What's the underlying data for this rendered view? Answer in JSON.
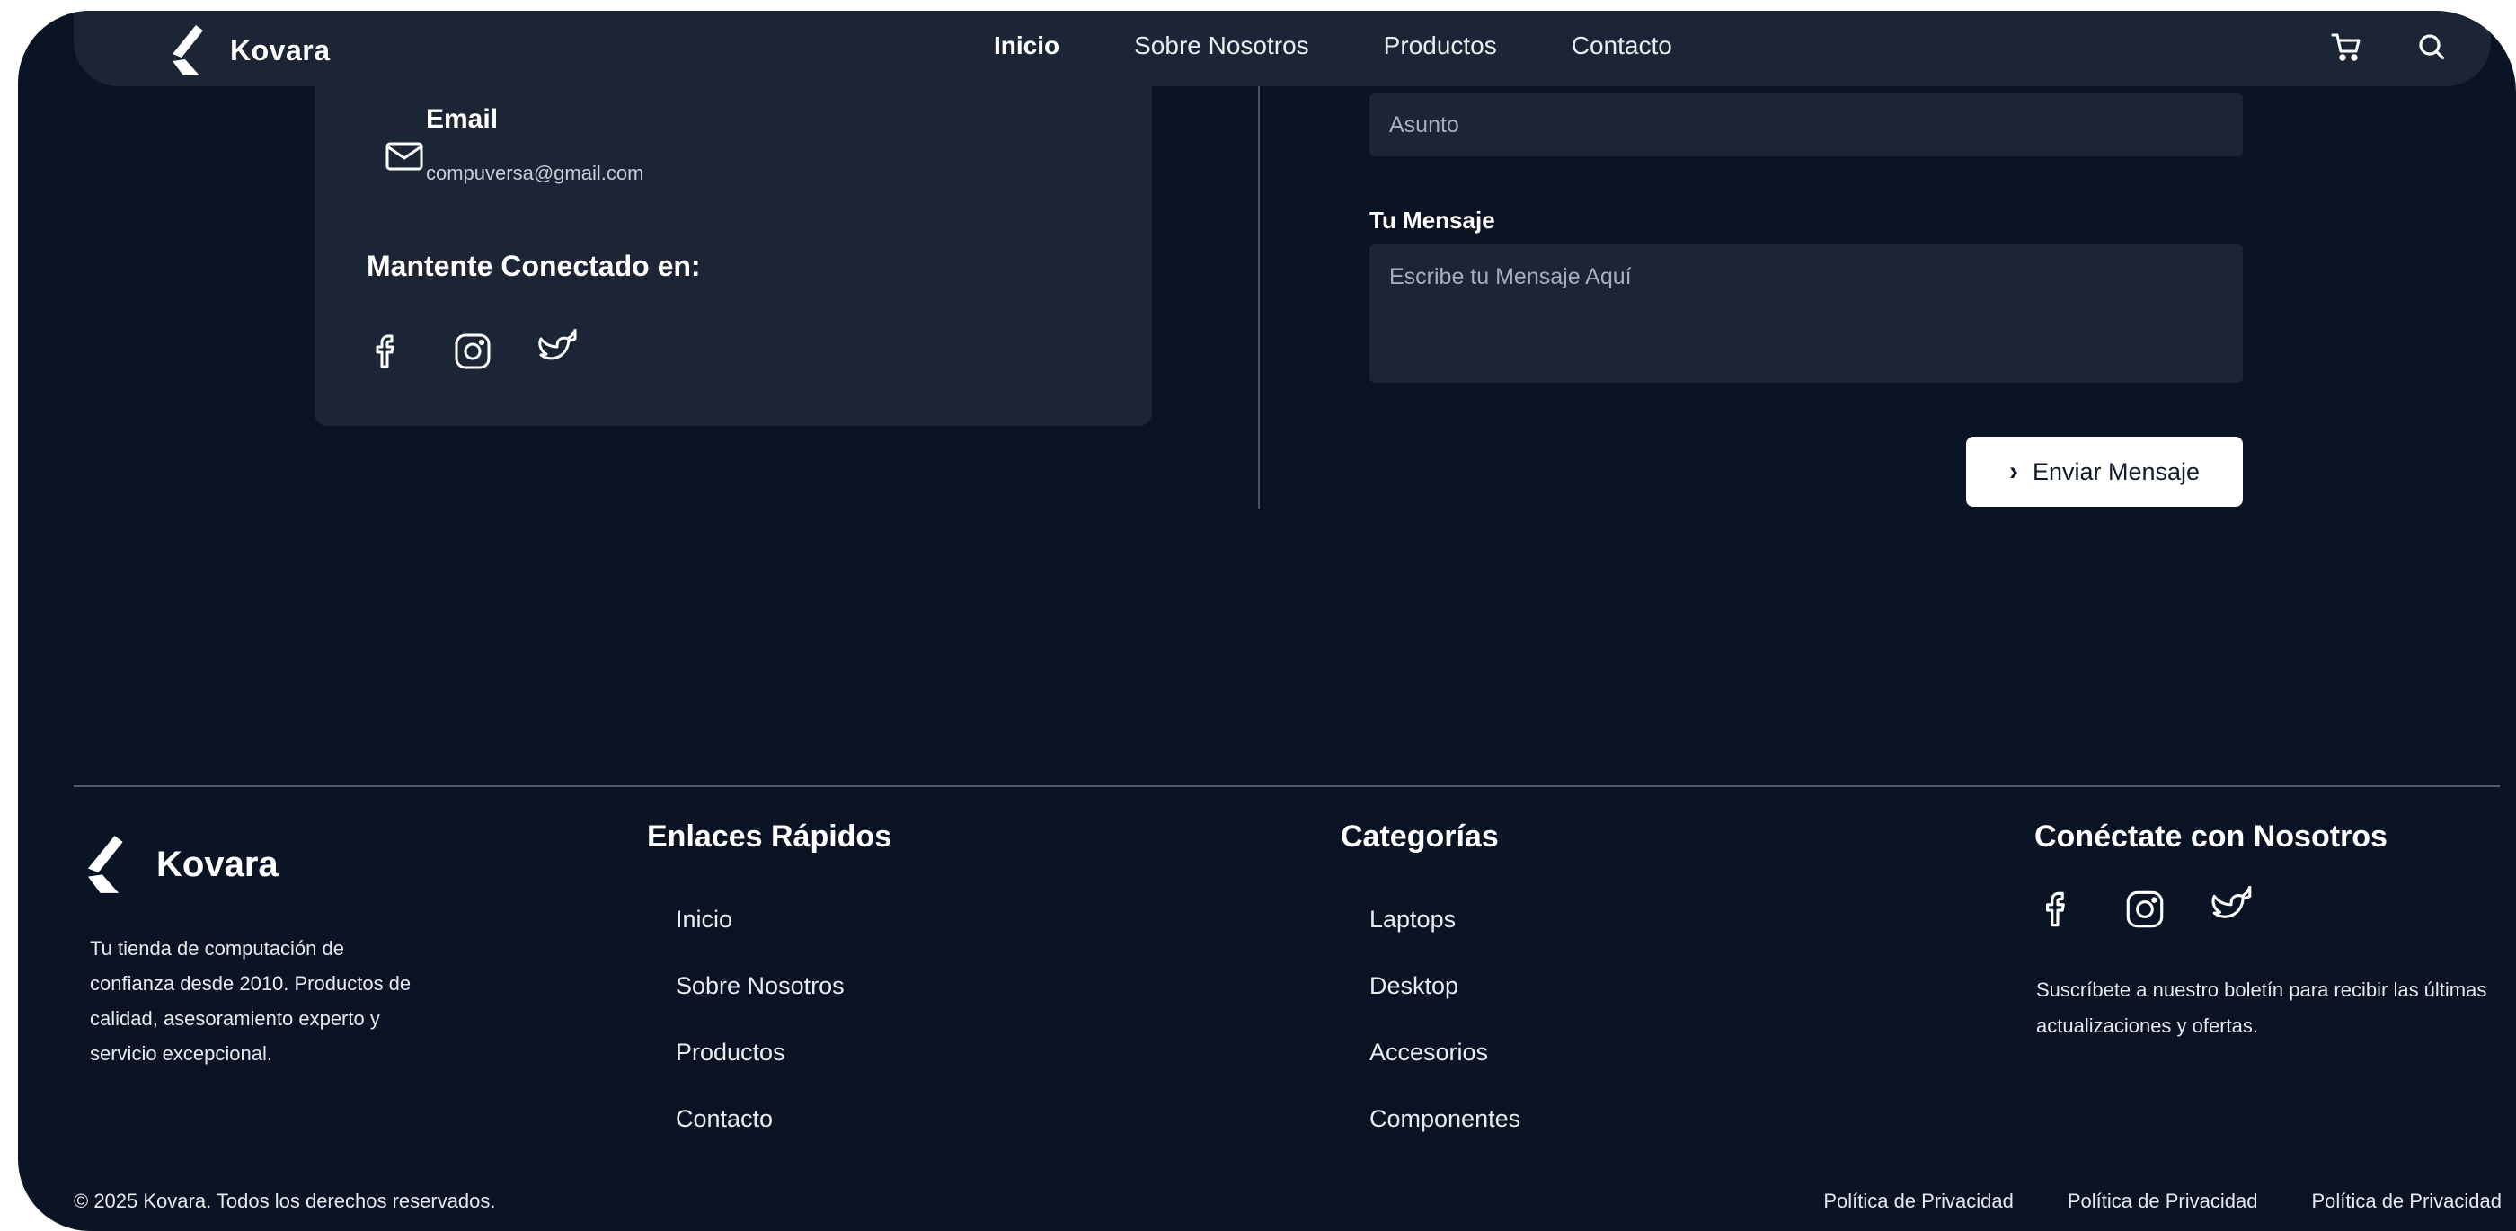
{
  "brand": {
    "name": "Kovara"
  },
  "nav": {
    "links": [
      "Inicio",
      "Sobre Nosotros",
      "Productos",
      "Contacto"
    ],
    "active": "Inicio",
    "icons": [
      "cart-icon",
      "search-icon"
    ]
  },
  "contact_card": {
    "email_title": "Email",
    "email_value": "compuversa@gmail.com",
    "connected_title": "Mantente Conectado en:",
    "socials": [
      "facebook-icon",
      "instagram-icon",
      "twitter-icon"
    ]
  },
  "form": {
    "subject_placeholder": "Asunto",
    "message_label": "Tu Mensaje",
    "message_placeholder": "Escribe tu Mensaje Aquí",
    "submit_label": "Enviar Mensaje"
  },
  "footer": {
    "brand": "Kovara",
    "description": "Tu tienda de computación de confianza desde 2010. Productos de calidad, asesoramiento experto y servicio excepcional.",
    "quick_links": {
      "title": "Enlaces Rápidos",
      "items": [
        "Inicio",
        "Sobre Nosotros",
        "Productos",
        "Contacto"
      ]
    },
    "categories": {
      "title": "Categorías",
      "items": [
        "Laptops",
        "Desktop",
        "Accesorios",
        "Componentes"
      ]
    },
    "connect": {
      "title": "Conéctate con Nosotros",
      "socials": [
        "facebook-icon",
        "instagram-icon",
        "twitter-icon"
      ],
      "newsletter": "Suscríbete a nuestro boletín para recibir las últimas actualizaciones y ofertas."
    },
    "copyright": "© 2025 Kovara. Todos los derechos reservados.",
    "legal": [
      "Política de Privacidad",
      "Política de Privacidad",
      "Política de Privacidad"
    ]
  },
  "colors": {
    "background": "#0b1425",
    "surface": "#1c2536",
    "text": "#ffffff",
    "button_bg": "#ffffff"
  }
}
